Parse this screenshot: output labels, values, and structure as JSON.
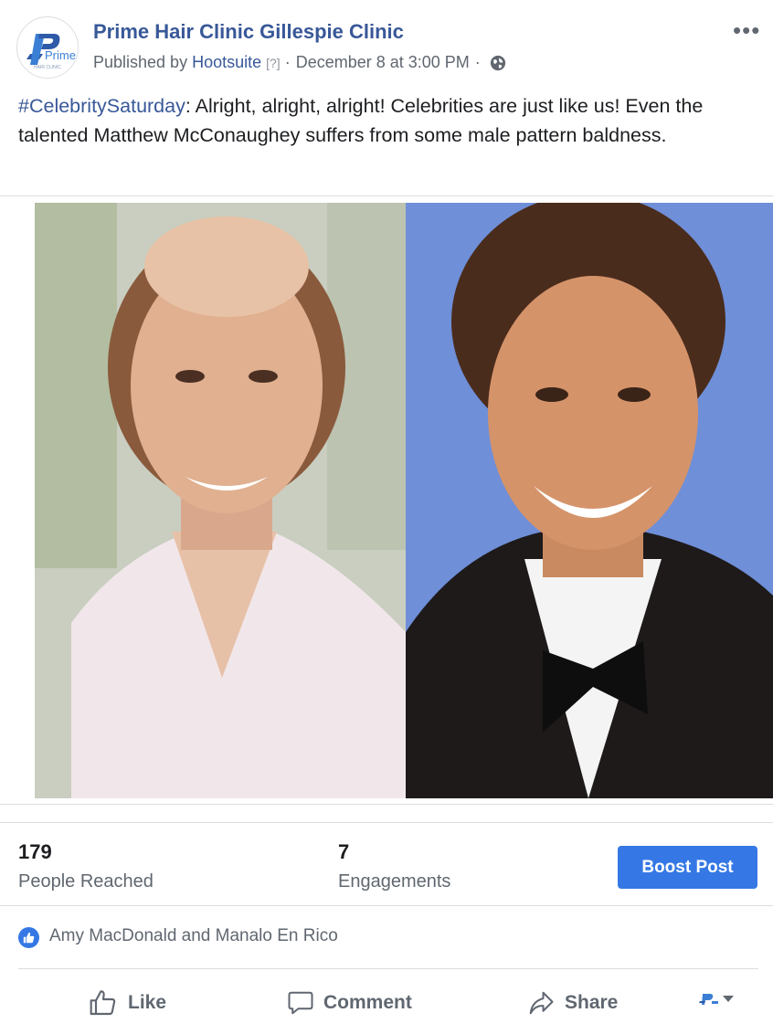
{
  "header": {
    "page_name": "Prime Hair Clinic Gillespie Clinic",
    "published_by_prefix": "Published by",
    "publisher": "Hootsuite",
    "help_marker": "[?]",
    "separator": "·",
    "timestamp": "December 8 at 3:00 PM",
    "audience_icon": "globe-icon",
    "more_label": "•••",
    "logo_text": "Prime",
    "logo_subtext": "HAIR CLINIC"
  },
  "post": {
    "hashtag": "#CelebritySaturday",
    "body": ": Alright, alright, alright! Celebrities are just like us! Even the talented Matthew McConaughey suffers from some male pattern baldness."
  },
  "insights": {
    "reached_value": "179",
    "reached_label": "People Reached",
    "engagements_value": "7",
    "engagements_label": "Engagements",
    "boost_label": "Boost Post"
  },
  "reactions": {
    "icon": "thumbs-up-icon",
    "names": "Amy MacDonald and Manalo En Rico"
  },
  "actions": {
    "like": "Like",
    "comment": "Comment",
    "share": "Share"
  },
  "colors": {
    "brand_blue": "#385898",
    "button_blue": "#3578e5",
    "secondary_text": "#606770",
    "divider": "#dadde1"
  }
}
